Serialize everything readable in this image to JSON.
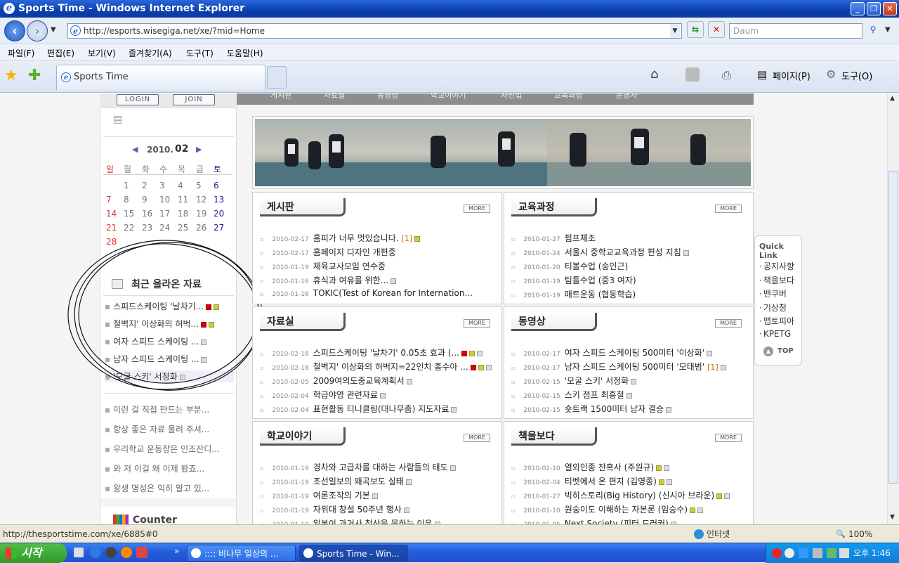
{
  "window": {
    "title": "Sports Time - Windows Internet Explorer"
  },
  "addressbar": {
    "url": "http://esports.wisegiga.net/xe/?mid=Home",
    "search_placeholder": "Daum"
  },
  "menubar": [
    "파일(F)",
    "편집(E)",
    "보기(V)",
    "즐겨찾기(A)",
    "도구(T)",
    "도움말(H)"
  ],
  "tab": {
    "title": "Sports Time"
  },
  "toolbar": {
    "page": "페이지(P)",
    "tools": "도구(O)"
  },
  "site": {
    "login": "LOGIN",
    "join": "JOIN",
    "nav": [
      "게시판",
      "자료실",
      "동영상",
      "학교이야기",
      "자선업",
      "교육과정",
      "운영자"
    ],
    "calendar": {
      "year": "2010.",
      "month": "02",
      "weekdays": [
        "일",
        "월",
        "화",
        "수",
        "목",
        "금",
        "토"
      ],
      "weeks": [
        [
          "",
          "1",
          "2",
          "3",
          "4",
          "5",
          "6"
        ],
        [
          "7",
          "8",
          "9",
          "10",
          "11",
          "12",
          "13"
        ],
        [
          "14",
          "15",
          "16",
          "17",
          "18",
          "19",
          "20"
        ],
        [
          "21",
          "22",
          "23",
          "24",
          "25",
          "26",
          "27"
        ],
        [
          "28",
          "",
          "",
          "",
          "",
          "",
          ""
        ]
      ],
      "today": "18"
    },
    "recent": {
      "title": "최근 올라온 자료",
      "items": [
        "스피드스케이팅 '날차기...",
        "철벽지' 이상화의 허벅...",
        "여자 스피드 스케이팅 ...",
        "남자 스피드 스케이팅 ...",
        "'모굴 스키' 서정화"
      ]
    },
    "comments": [
      "이런 걸 직접 만드는 부분...",
      "항상 좋은 자료 올려 주셔...",
      "우리학교 운동장은 인조잔디...",
      "와 저 이걸 왜 이제 봤죠...",
      "왕생 명성은 익히 알고 있..."
    ],
    "counter": "Counter",
    "more": "MORE",
    "panels": [
      {
        "title": "게시판",
        "rows": [
          [
            "2010-02-17",
            "홈피가 너무 멋있습니다.",
            "[1]"
          ],
          [
            "2010-02-17",
            "홈페이지 디자인 개편중",
            ""
          ],
          [
            "2010-01-19",
            "체육교사모임 연수중",
            ""
          ],
          [
            "2010-01-16",
            "휴식과 여유를 위한...",
            ""
          ],
          [
            "2010-01-16",
            "TOKIC(Test of Korean for Internation...",
            ""
          ]
        ]
      },
      {
        "title": "교육과정",
        "rows": [
          [
            "2010-01-27",
            "펌프체조",
            ""
          ],
          [
            "2010-01-24",
            "서울시 중학교교육과정 편성 지침",
            ""
          ],
          [
            "2010-01-20",
            "티볼수업 (송인근)",
            ""
          ],
          [
            "2010-01-19",
            "팀틀수업 (중3 여자)",
            ""
          ],
          [
            "2010-01-19",
            "매트운동 (협동학습)",
            ""
          ]
        ]
      },
      {
        "title": "자료실",
        "rows": [
          [
            "2010-02-18",
            "스피드스케이팅 '날차기' 0.05초 효과 (...",
            ""
          ],
          [
            "2010-02-18",
            "철벽지' 이상화의 허벅지=22인치 홍수아 ...",
            ""
          ],
          [
            "2010-02-05",
            "2009여의도중교육계획서",
            ""
          ],
          [
            "2010-02-04",
            "학급야영 관련자료",
            ""
          ],
          [
            "2010-02-04",
            "표현활동 티니클링(대나무춤) 지도자료",
            ""
          ]
        ]
      },
      {
        "title": "동영상",
        "rows": [
          [
            "2010-02-17",
            "여자 스피드 스케이팅 500미터 '이상화'",
            ""
          ],
          [
            "2010-02-17",
            "남자 스피드 스케이팅 500미터 '모태범'",
            "[1]"
          ],
          [
            "2010-02-15",
            "'모굴 스키' 서정화",
            ""
          ],
          [
            "2010-02-15",
            "스키 점프 최흥철",
            ""
          ],
          [
            "2010-02-15",
            "숏트랙 1500미터 남자 결승",
            ""
          ]
        ]
      },
      {
        "title": "학교이야기",
        "rows": [
          [
            "2010-01-19",
            "경차와 고급차를 대하는 사람들의 태도",
            ""
          ],
          [
            "2010-01-19",
            "조선일보의 왜곡보도 실태",
            ""
          ],
          [
            "2010-01-19",
            "여론조작의 기본",
            ""
          ],
          [
            "2010-01-19",
            "자위대 창설 50주년 행사",
            ""
          ],
          [
            "2010-01-19",
            "일본이 과거사 청산을 못하는 이유",
            ""
          ]
        ]
      },
      {
        "title": "책을보다",
        "rows": [
          [
            "2010-02-10",
            "열외인종 잔혹사 (주원규)",
            ""
          ],
          [
            "2010-02-04",
            "티벳에서 온 편지 (김영종)",
            ""
          ],
          [
            "2010-01-27",
            "빅히스토리(Big History) (신시아 브라운)",
            ""
          ],
          [
            "2010-01-10",
            "원숭이도 이해하는 자본론 (임승수)",
            ""
          ],
          [
            "2010-01-05",
            "Next Society (피터 드러커)",
            ""
          ]
        ]
      }
    ],
    "quicklink": {
      "title": "Quick Link",
      "items": [
        "공지사항",
        "책을보다",
        "밴쿠버",
        "기상청",
        "맵토피아",
        "KPETG"
      ],
      "top": "TOP"
    }
  },
  "status": {
    "url": "http://thesportstime.com/xe/6885#0",
    "zone": "인터넷",
    "zoom": "100%"
  },
  "taskbar": {
    "start": "시작",
    "tasks": [
      ":::: 비나무 일상의 ...",
      "Sports Time - Win..."
    ],
    "clock": "오후 1:46"
  }
}
